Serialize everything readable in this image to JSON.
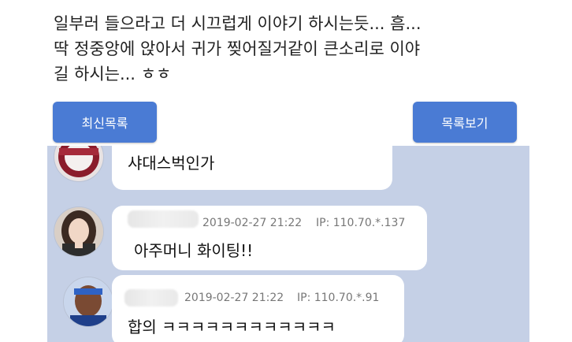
{
  "post": {
    "lines": [
      "일부러 들으라고 더 시끄럽게 이야기 하시는듯... 흠...",
      "딱 정중앙에 앉아서 귀가 찢어질거같이 큰소리로 이야",
      "길 하시는... ㅎㅎ"
    ]
  },
  "buttons": {
    "latest": "최신목록",
    "list": "목록보기"
  },
  "comments": [
    {
      "text": "샤대스벅인가",
      "avatar_icon": "team-logo-avatar"
    },
    {
      "date": "2019-02-27 21:22",
      "ip": "IP: 110.70.*.137",
      "text": "아주머니 화이팅!!",
      "avatar_icon": "woman-avatar"
    },
    {
      "date": "2019-02-27 21:22",
      "ip": "IP: 110.70.*.91",
      "text": "합의 ㅋㅋㅋㅋㅋㅋㅋㅋㅋㅋㅋㅋ",
      "avatar_icon": "basketball-player-avatar"
    }
  ],
  "colors": {
    "button": "#4a7bd4",
    "chat_background": "#c5d0e6",
    "bubble": "#ffffff",
    "meta_text": "#777777"
  }
}
